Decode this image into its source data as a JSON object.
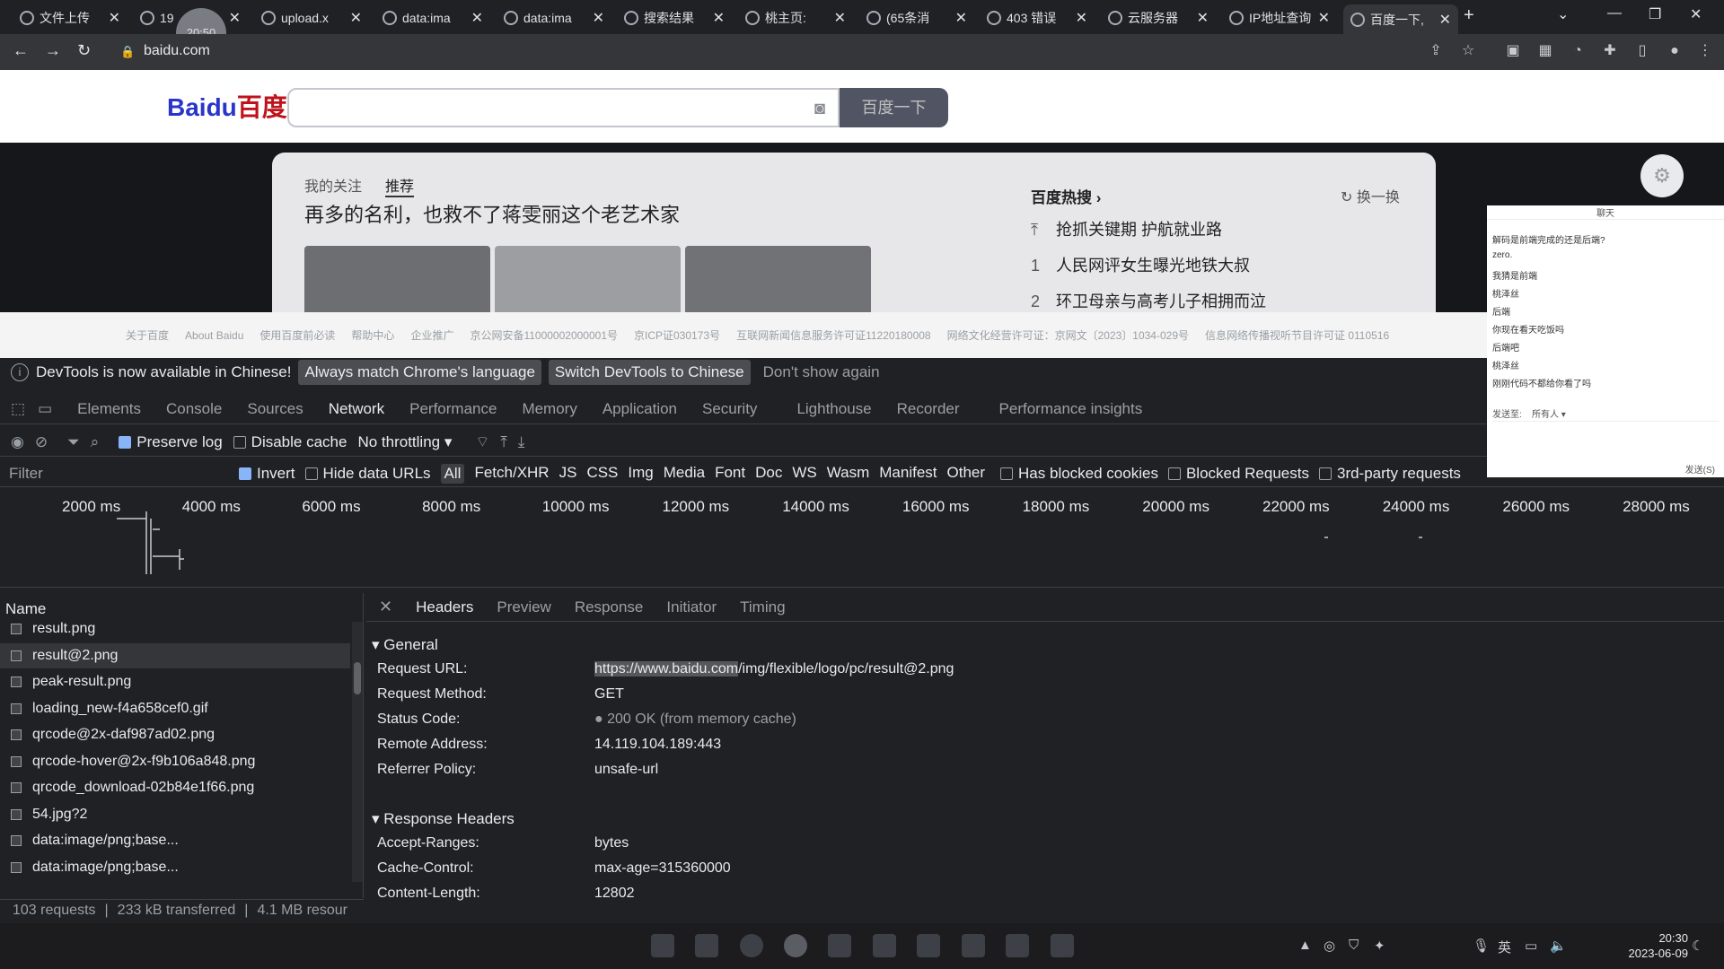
{
  "browser": {
    "tabs": [
      {
        "title": "文件上传"
      },
      {
        "title": "19"
      },
      {
        "title": "upload.x"
      },
      {
        "title": "data:ima"
      },
      {
        "title": "data:ima"
      },
      {
        "title": "搜索结果"
      },
      {
        "title": "桃主页:"
      },
      {
        "title": "(65条消"
      },
      {
        "title": "403 错误"
      },
      {
        "title": "云服务器"
      },
      {
        "title": "IP地址查询"
      },
      {
        "title": "百度一下,"
      }
    ],
    "new_tab_symbol": "+",
    "address": "baidu.com",
    "time_badge": "20:50"
  },
  "baidu": {
    "logo_latin": "Bai",
    "logo_cn": "百度",
    "search_button": "百度一下",
    "feed_tabs": [
      "我的关注",
      "推荐"
    ],
    "feed_title": "再多的名利，也救不了蒋雯丽这个老艺术家",
    "hot_heading": "百度热搜",
    "refresh": "换一换",
    "hot_items": [
      {
        "rank": "",
        "text": "抢抓关键期 护航就业路"
      },
      {
        "rank": "1",
        "text": "人民网评女生曝光地铁大叔"
      },
      {
        "rank": "2",
        "text": "环卫母亲与高考儿子相拥而泣"
      }
    ],
    "footer_links": [
      "关于百度",
      "About Baidu",
      "使用百度前必读",
      "帮助中心",
      "企业推广",
      "京公网安备11000002000001号",
      "京ICP证030173号",
      "互联网新闻信息服务许可证11220180008",
      "网络文化经营许可证：京网文〔2023〕1034-029号",
      "信息网络传播视听节目许可证 0110516"
    ]
  },
  "devtools": {
    "infobar": {
      "message": "DevTools is now available in Chinese!",
      "btn_match": "Always match Chrome's language",
      "btn_switch": "Switch DevTools to Chinese",
      "btn_dismiss": "Don't show again"
    },
    "tabs": [
      "Elements",
      "Console",
      "Sources",
      "Network",
      "Performance",
      "Memory",
      "Application",
      "Security",
      "Lighthouse",
      "Recorder",
      "Performance insights"
    ],
    "selected_tab": "Network",
    "toolbar": {
      "preserve_log": "Preserve log",
      "disable_cache": "Disable cache",
      "throttling": "No throttling"
    },
    "filter": {
      "label": "Filter",
      "invert": "Invert",
      "hide_data_urls": "Hide data URLs",
      "types": [
        "All",
        "Fetch/XHR",
        "JS",
        "CSS",
        "Img",
        "Media",
        "Font",
        "Doc",
        "WS",
        "Wasm",
        "Manifest",
        "Other"
      ],
      "blocked_cookies": "Has blocked cookies",
      "blocked_requests": "Blocked Requests",
      "third_party": "3rd-party requests"
    },
    "timeline_ticks": [
      "2000 ms",
      "4000 ms",
      "6000 ms",
      "8000 ms",
      "10000 ms",
      "12000 ms",
      "14000 ms",
      "16000 ms",
      "18000 ms",
      "20000 ms",
      "22000 ms",
      "24000 ms",
      "26000 ms",
      "28000 ms"
    ],
    "requests": {
      "header": "Name",
      "rows": [
        {
          "name": "result.png"
        },
        {
          "name": "result@2.png",
          "selected": true
        },
        {
          "name": "peak-result.png"
        },
        {
          "name": "loading_new-f4a658cef0.gif"
        },
        {
          "name": "qrcode@2x-daf987ad02.png"
        },
        {
          "name": "qrcode-hover@2x-f9b106a848.png"
        },
        {
          "name": "qrcode_download-02b84e1f66.png"
        },
        {
          "name": "54.jpg?2"
        },
        {
          "name": "data:image/png;base..."
        },
        {
          "name": "data:image/png;base..."
        }
      ]
    },
    "status": {
      "requests": "103 requests",
      "transferred": "233 kB transferred",
      "resources": "4.1 MB resour"
    },
    "detail": {
      "tabs": [
        "Headers",
        "Preview",
        "Response",
        "Initiator",
        "Timing"
      ],
      "general_heading": "General",
      "general": [
        {
          "key": "Request URL:",
          "value_host": "https://www.baidu.com",
          "value_path": "/img/flexible/logo/pc/result@2.png"
        },
        {
          "key": "Request Method:",
          "value": "GET"
        },
        {
          "key": "Status Code:",
          "value": "200 OK (from memory cache)"
        },
        {
          "key": "Remote Address:",
          "value": "14.119.104.189:443"
        },
        {
          "key": "Referrer Policy:",
          "value": "unsafe-url"
        }
      ],
      "response_heading": "Response Headers",
      "response": [
        {
          "key": "Accept-Ranges:",
          "value": "bytes"
        },
        {
          "key": "Cache-Control:",
          "value": "max-age=315360000"
        },
        {
          "key": "Content-Length:",
          "value": "12802"
        }
      ]
    }
  },
  "chat": {
    "title": "聊天",
    "messages": [
      "解码是前端完成的还是后端?",
      "zero.",
      "我猜是前端",
      "桃泽丝",
      "后端",
      "你现在看天吃饭吗",
      "后端吧",
      "桃泽丝",
      "刚刚代码不都给你看了吗"
    ],
    "send_to_label": "发送至:",
    "send_to_value": "所有人",
    "send_button": "发送(S)"
  },
  "taskbar": {
    "time": "20:30",
    "date": "2023-06-09",
    "ime": "英"
  }
}
